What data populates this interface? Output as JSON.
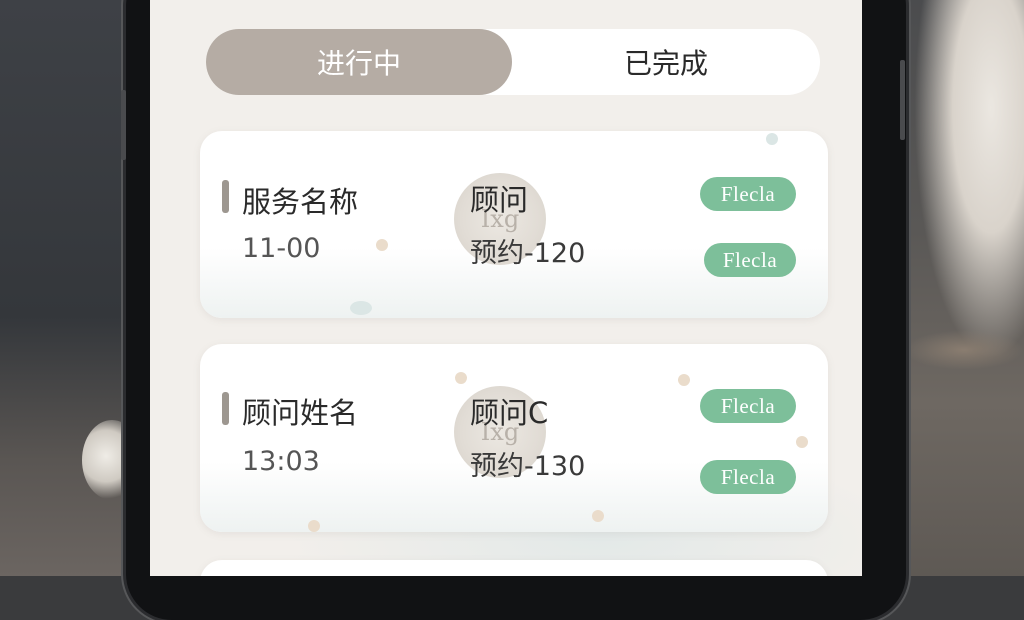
{
  "tabs": [
    {
      "label": "进行中",
      "active": true
    },
    {
      "label": "已完成",
      "active": false
    }
  ],
  "cards": [
    {
      "service_name": "服务名称",
      "time": "11-00",
      "consultant": "顾问",
      "booking": "预约-120",
      "stamp_text": "Ixg",
      "badges": [
        "Flecla",
        "Flecla"
      ]
    },
    {
      "service_name": "顾问姓名",
      "time": "13:03",
      "consultant": "顾问C",
      "booking": "预约-130",
      "stamp_text": "Ixg",
      "badges": [
        "Flecla",
        "Flecla"
      ]
    }
  ],
  "colors": {
    "active_tab": "#b5aca4",
    "badge": "#7dbf9a",
    "screen_bg": "#f2efeb"
  }
}
